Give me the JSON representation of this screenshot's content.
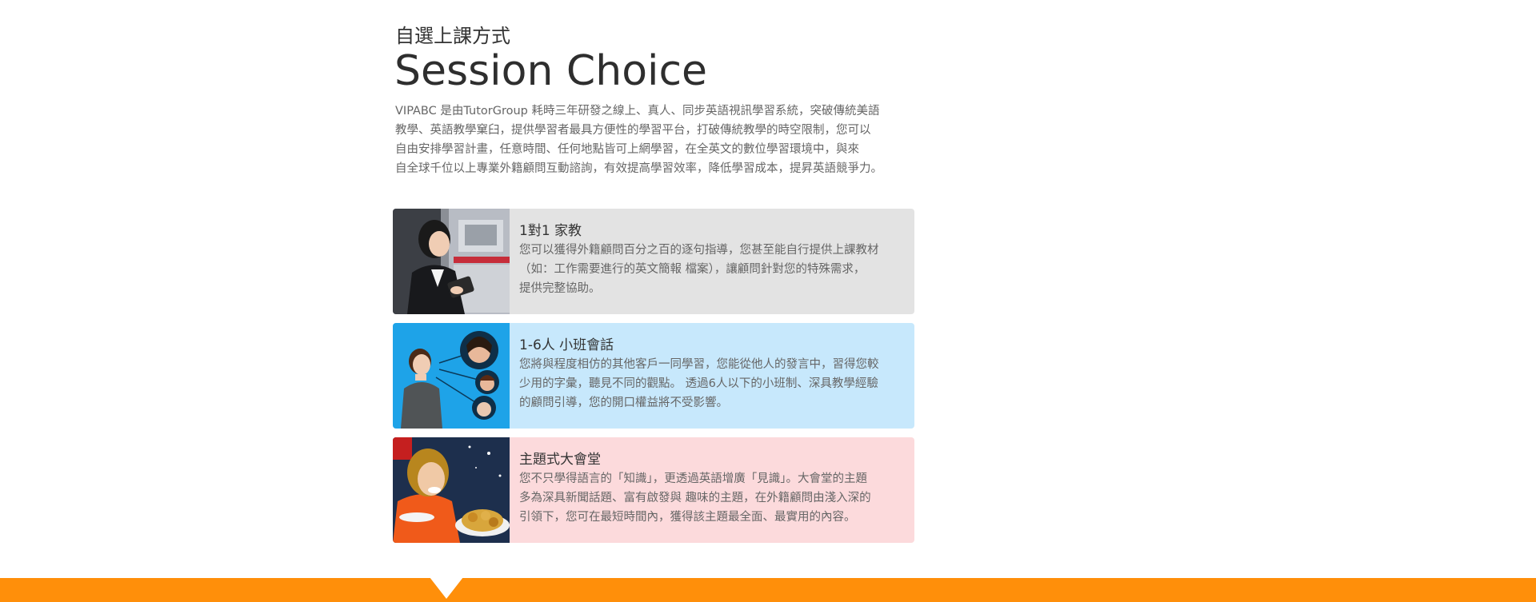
{
  "section": {
    "subtitle_zh": "自選上課方式",
    "title_en": "Session Choice",
    "intro": [
      "VIPABC 是由TutorGroup 耗時三年研發之線上、真人、同步英語視訊學習系統，突破傳統美語",
      "教學、英語教學窠臼，提供學習者最具方便性的學習平台，打破傳統教學的時空限制，您可以",
      "自由安排學習計畫，任意時間、任何地點皆可上網學習，在全英文的數位學習環境中，與來",
      "自全球千位以上專業外籍顧問互動諮詢，有效提高學習效率，降低學習成本，提昇英語競爭力。"
    ]
  },
  "cards": [
    {
      "title": "1對1 家教",
      "desc": [
        "您可以獲得外籍顧問百分之百的逐句指導，您甚至能自行提供上課教材",
        "（如：工作需要進行的英文簡報 檔案），讓顧問針對您的特殊需求，",
        "提供完整協助。"
      ],
      "bg": "#e3e3e3",
      "image": "woman-with-tablet-photo"
    },
    {
      "title": "1-6人 小班會話",
      "desc": [
        "您將與程度相仿的其他客戶一同學習，您能從他人的發言中，習得您較",
        "少用的字彙，聽見不同的觀點。 透過6人以下的小班制、深具教學經驗",
        "的顧問引導，您的開口權益將不受影響。"
      ],
      "bg": "#c7e8fc",
      "image": "group-session-photo"
    },
    {
      "title": "主題式大會堂",
      "desc": [
        "您不只學得語言的「知識」，更透過英語增廣「見識」。大會堂的主題",
        "多為深具新聞話題、富有啟發與 趣味的主題，在外籍顧問由淺入深的",
        "引領下，您可在最短時間內，獲得該主題最全面、最實用的內容。"
      ],
      "bg": "#fcdadc",
      "image": "woman-eating-photo"
    }
  ],
  "footer": {
    "bar_color": "#ff8f0a"
  }
}
